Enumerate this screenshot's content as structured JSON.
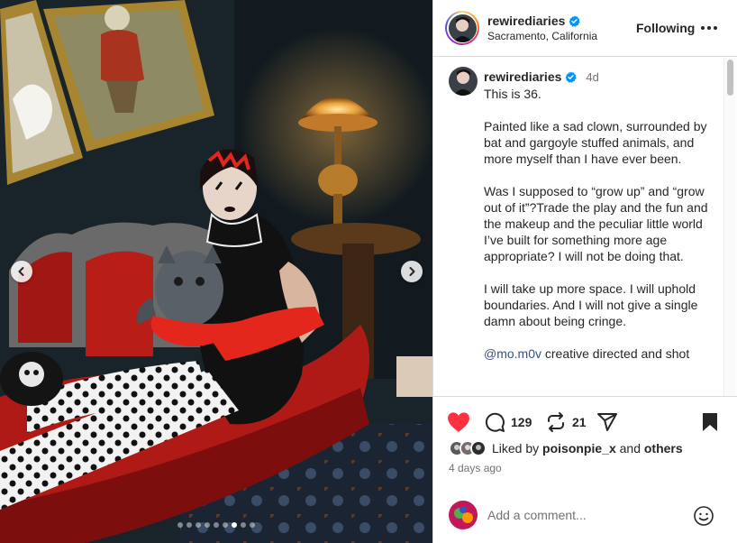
{
  "post": {
    "username": "rewirediaries",
    "location": "Sacramento, California",
    "follow_label": "Following",
    "more_icon": "more-horizontal-icon",
    "verified_icon": "verified-badge-icon",
    "verified_color": "#0095f6"
  },
  "carousel": {
    "total_slides": 9,
    "active_slide": 7,
    "prev_icon": "chevron-left-icon",
    "next_icon": "chevron-right-icon"
  },
  "caption": {
    "username": "rewirediaries",
    "time": "4d",
    "paragraphs": [
      "This is 36.",
      "Painted like a sad clown, surrounded by bat and gargoyle stuffed animals, and more myself than I have ever been.",
      "Was I supposed to “grow up” and “grow out of it”?Trade the play and the fun and the makeup and the peculiar little world I’ve built for something more age appropriate? I will not be doing that.",
      "I will take up more space. I will uphold boundaries. And I will not give a single damn about being cringe."
    ],
    "mention": "@mo.m0v",
    "mention_rest": " creative directed and shot"
  },
  "actions": {
    "like_icon": "heart-filled-icon",
    "like_color": "#ff3040",
    "comment_icon": "comment-icon",
    "comment_count": "129",
    "repost_icon": "repost-icon",
    "repost_count": "21",
    "share_icon": "send-icon",
    "save_icon": "bookmark-filled-icon"
  },
  "likes": {
    "prefix": "Liked by ",
    "user": "poisonpie_x",
    "middle": " and ",
    "others": "others"
  },
  "timestamp": "4 days ago",
  "comment_box": {
    "placeholder": "Add a comment...",
    "emoji_icon": "smiley-icon"
  }
}
